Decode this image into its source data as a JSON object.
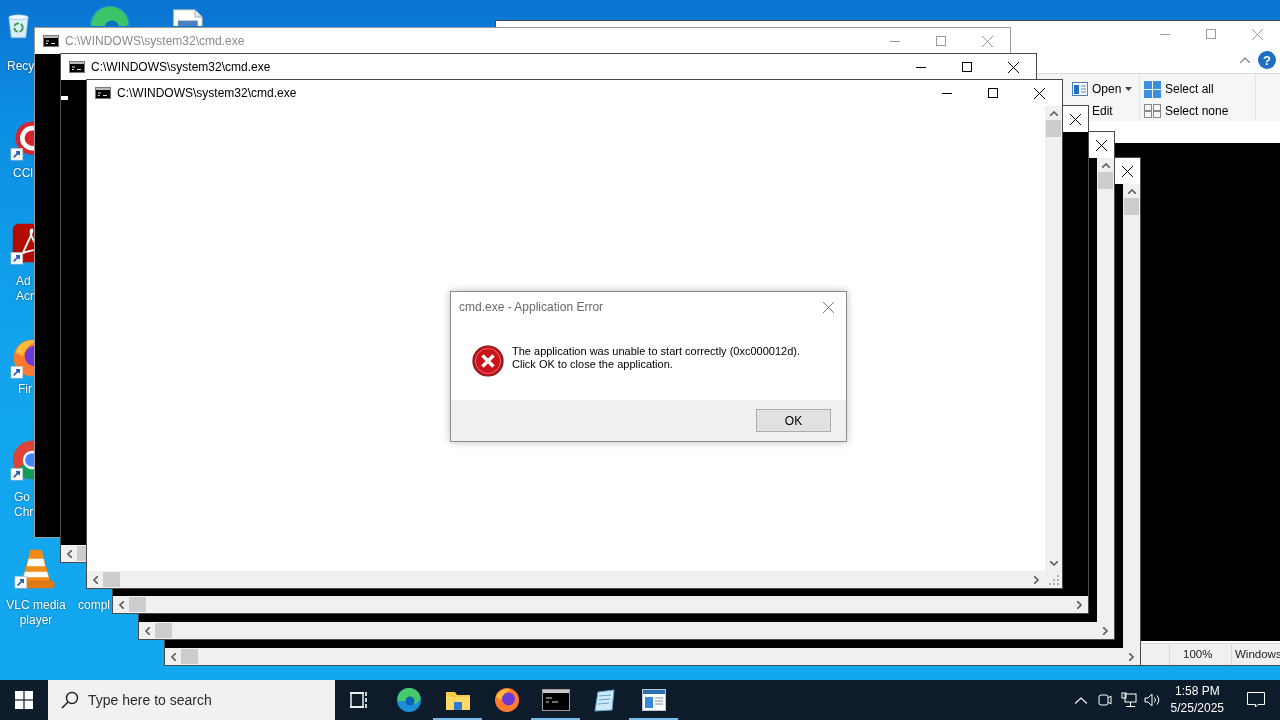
{
  "desktop_icons": [
    {
      "kind": "recycle-bin",
      "label": "Recy"
    },
    {
      "kind": "edge"
    },
    {
      "kind": "document"
    },
    {
      "kind": "ccleaner",
      "label": "CCl"
    },
    {
      "kind": "acrobat",
      "label": "Ad\nAcr"
    },
    {
      "kind": "firefox",
      "label": "Fir"
    },
    {
      "kind": "chrome",
      "label": "Go\nChr"
    },
    {
      "kind": "vlc",
      "label": "VLC media\nplayer"
    },
    {
      "kind": "label-only",
      "label": "compl"
    }
  ],
  "explorer": {
    "help": "?",
    "ribbon_groups": [
      {
        "items": [
          {
            "kind": "open",
            "label": "Open",
            "dropdown": true
          },
          {
            "kind": "edit",
            "label": "Edit",
            "dropdown": false
          }
        ]
      },
      {
        "items": [
          {
            "kind": "select-all",
            "label": "Select all",
            "dropdown": false
          },
          {
            "kind": "select-none",
            "label": "Select none",
            "dropdown": false
          }
        ]
      }
    ],
    "status_bar": [
      "100%",
      "Windows"
    ]
  },
  "console_windows": [
    {
      "title": "C:\\WINDOWS\\system32\\cmd.exe",
      "dimmed": true
    },
    {
      "title": "C:\\WINDOWS\\system32\\cmd.exe",
      "dimmed": false
    },
    {
      "title": "C:\\WINDOWS\\system32\\cmd.exe",
      "dimmed": false
    }
  ],
  "dialog": {
    "title": "cmd.exe - Application Error",
    "message": "The application was unable to start correctly (0xc000012d). Click OK to close the application.",
    "buttons": [
      "OK"
    ]
  },
  "taskbar": {
    "search": {
      "placeholder": "Type here to search"
    },
    "apps": [
      {
        "kind": "task-view",
        "running": false
      },
      {
        "kind": "edge",
        "running": false
      },
      {
        "kind": "folder",
        "running": true
      },
      {
        "kind": "firefox",
        "running": false
      },
      {
        "kind": "terminal",
        "running": true
      },
      {
        "kind": "notepad",
        "running": false
      },
      {
        "kind": "window",
        "running": true
      }
    ],
    "clock": {
      "time": "1:58 PM",
      "date": "5/25/2025"
    }
  }
}
